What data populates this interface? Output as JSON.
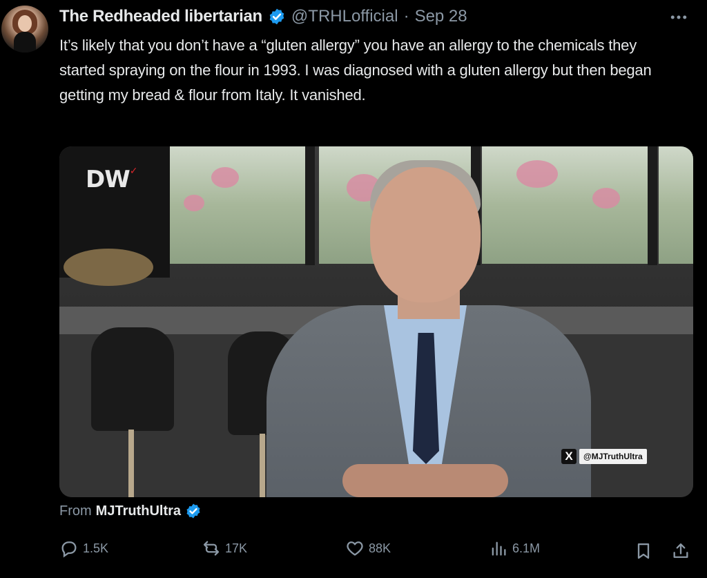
{
  "author": {
    "name": "The Redheaded libertarian",
    "handle": "@TRHLofficial",
    "separator": "·",
    "date": "Sep 28",
    "verified": true
  },
  "more_icon": "more-horizontal-icon",
  "tweet_text": "It’s likely that you don’t have a “gluten allergy” you have an allergy to the chemicals they started spraying on the flour in 1993. I was diagnosed with a gluten allergy but then began getting my bread & flour from Italy. It vanished.",
  "media": {
    "logo_text": "DW",
    "watermark_x": "X",
    "watermark_text": "@MJTruthUltra"
  },
  "from": {
    "prefix": "From",
    "source": "MJTruthUltra",
    "verified": true
  },
  "actions": {
    "replies": "1.5K",
    "reposts": "17K",
    "likes": "88K",
    "views": "6.1M"
  },
  "colors": {
    "background": "#000000",
    "text": "#e7e9ea",
    "muted": "#8b98a5",
    "verified_blue": "#1d9bf0"
  }
}
